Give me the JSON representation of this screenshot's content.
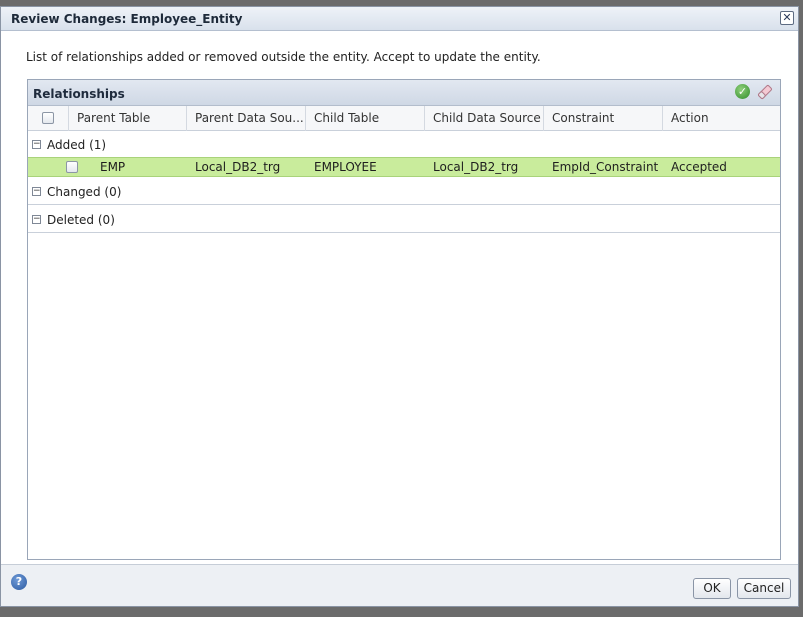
{
  "dialog": {
    "title": "Review Changes: Employee_Entity",
    "close_symbol": "✕",
    "instructions": "List of relationships added or removed outside the entity. Accept to update the entity."
  },
  "panel": {
    "title": "Relationships",
    "accept_icon": "check-circle-icon",
    "clear_icon": "eraser-icon"
  },
  "columns": [
    "Parent Table",
    "Parent Data Sou...",
    "Child Table",
    "Child Data Source",
    "Constraint",
    "Action"
  ],
  "groups": {
    "added": {
      "label": "Added",
      "count": "(1)",
      "toggle": "⊟"
    },
    "changed": {
      "label": "Changed",
      "count": "(0)",
      "toggle": "⊟"
    },
    "deleted": {
      "label": "Deleted",
      "count": "(0)",
      "toggle": "⊟"
    }
  },
  "rows": [
    {
      "parent_table": "EMP",
      "parent_data_source": "Local_DB2_trg",
      "child_table": "EMPLOYEE",
      "child_data_source": "Local_DB2_trg",
      "constraint": "EmpId_Constraint",
      "action": "Accepted",
      "highlight_color": "#c9ec9c"
    }
  ],
  "footer": {
    "help_icon": "help-icon",
    "help_symbol": "?",
    "ok_label": "OK",
    "cancel_label": "Cancel"
  }
}
